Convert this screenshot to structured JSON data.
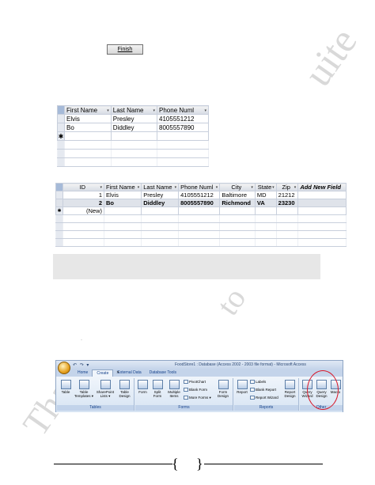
{
  "finish_button": {
    "label": "Finish"
  },
  "table1": {
    "columns": [
      "First Name",
      "Last Name",
      "Phone Numl"
    ],
    "rows": [
      [
        "Elvis",
        "Presley",
        "4105551212"
      ],
      [
        "Bo",
        "Diddley",
        "8005557890"
      ]
    ],
    "new_row_marker": "✱"
  },
  "table2": {
    "columns": [
      "ID",
      "First Name",
      "Last Name",
      "Phone Numl",
      "City",
      "State",
      "Zip",
      "Add New Field"
    ],
    "rows": [
      [
        "1",
        "Elvis",
        "Presley",
        "4105551212",
        "Baltimore",
        "MD",
        "21212"
      ],
      [
        "2",
        "Bo",
        "Diddley",
        "8005557890",
        "Richmond",
        "VA",
        "23230"
      ]
    ],
    "new_row_marker": "✱",
    "new_row_label": "(New)"
  },
  "ribbon": {
    "title": "FoodStore1 : Database (Access 2002 - 2003 file format) - Microsoft Access",
    "quick_access": "↶ ↷ ▾",
    "tabs": [
      "Home",
      "Create",
      "External Data",
      "Database Tools"
    ],
    "active_tab": "Create",
    "groups": {
      "tables": {
        "label": "Tables",
        "buttons": [
          "Table",
          "Table Templates",
          "SharePoint Lists",
          "Table Design"
        ]
      },
      "forms": {
        "label": "Forms",
        "buttons": [
          "Form",
          "Split Form",
          "Multiple Items",
          "Form Design"
        ],
        "small_buttons": [
          "PivotChart",
          "Blank Form",
          "More Forms"
        ]
      },
      "reports": {
        "label": "Reports",
        "buttons": [
          "Report",
          "Report Design"
        ],
        "small_buttons": [
          "Labels",
          "Blank Report",
          "Report Wizard"
        ]
      },
      "other": {
        "label": "Other",
        "buttons": [
          "Query Wizard",
          "Query Design",
          "Macro"
        ]
      }
    },
    "highlight_color": "#d8182a"
  },
  "watermark": {
    "top": "uite",
    "middle": "to",
    "left": "Tha"
  },
  "footer": {
    "left_brace": "{",
    "right_brace": "}"
  }
}
